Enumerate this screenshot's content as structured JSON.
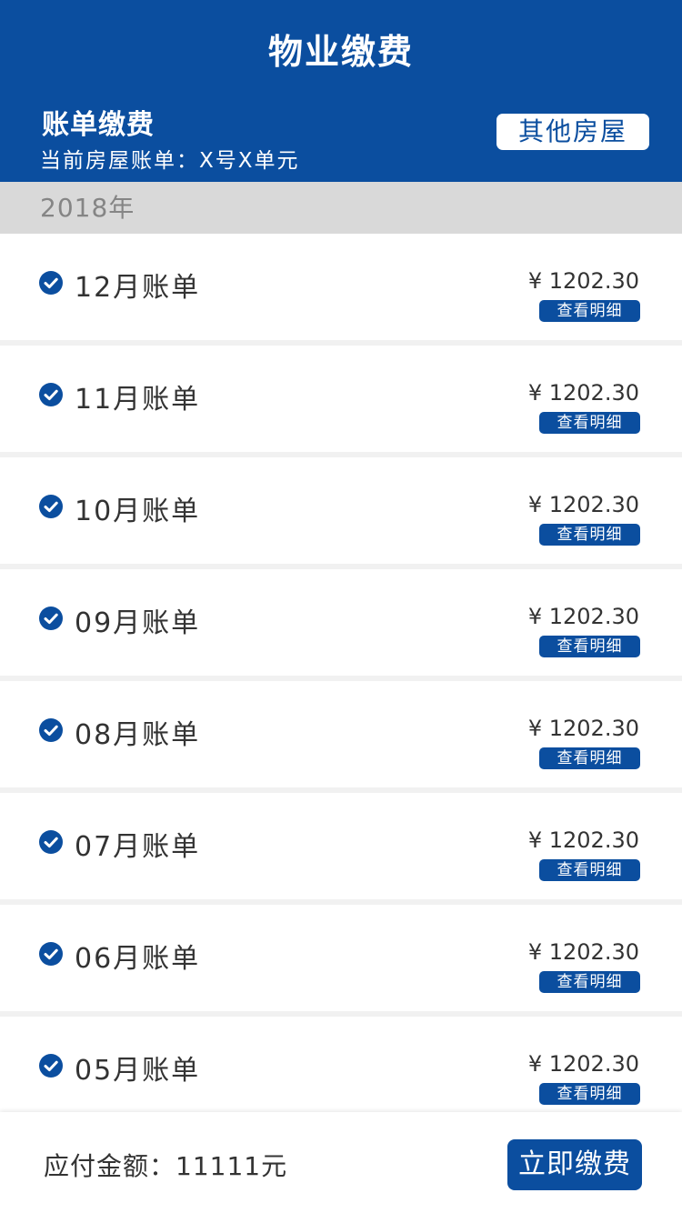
{
  "header": {
    "title": "物业缴费",
    "account_title": "账单缴费",
    "house_info": "当前房屋账单：X号X单元",
    "other_house_label": "其他房屋"
  },
  "year_label": "2018年",
  "bills": [
    {
      "label": "12月账单",
      "amount": "¥ 1202.30",
      "detail_label": "查看明细"
    },
    {
      "label": "11月账单",
      "amount": "¥ 1202.30",
      "detail_label": "查看明细"
    },
    {
      "label": "10月账单",
      "amount": "¥ 1202.30",
      "detail_label": "查看明细"
    },
    {
      "label": "09月账单",
      "amount": "¥ 1202.30",
      "detail_label": "查看明细"
    },
    {
      "label": "08月账单",
      "amount": "¥ 1202.30",
      "detail_label": "查看明细"
    },
    {
      "label": "07月账单",
      "amount": "¥ 1202.30",
      "detail_label": "查看明细"
    },
    {
      "label": "06月账单",
      "amount": "¥ 1202.30",
      "detail_label": "查看明细"
    },
    {
      "label": "05月账单",
      "amount": "¥ 1202.30",
      "detail_label": "查看明细"
    }
  ],
  "footer": {
    "total_text": "应付金额：11111元",
    "pay_label": "立即缴费"
  },
  "colors": {
    "brand": "#0b4e9f",
    "year_bar": "#d9d9d9",
    "background": "#f1f1f1"
  },
  "icons": {
    "bill_check": "check-circle-icon"
  }
}
